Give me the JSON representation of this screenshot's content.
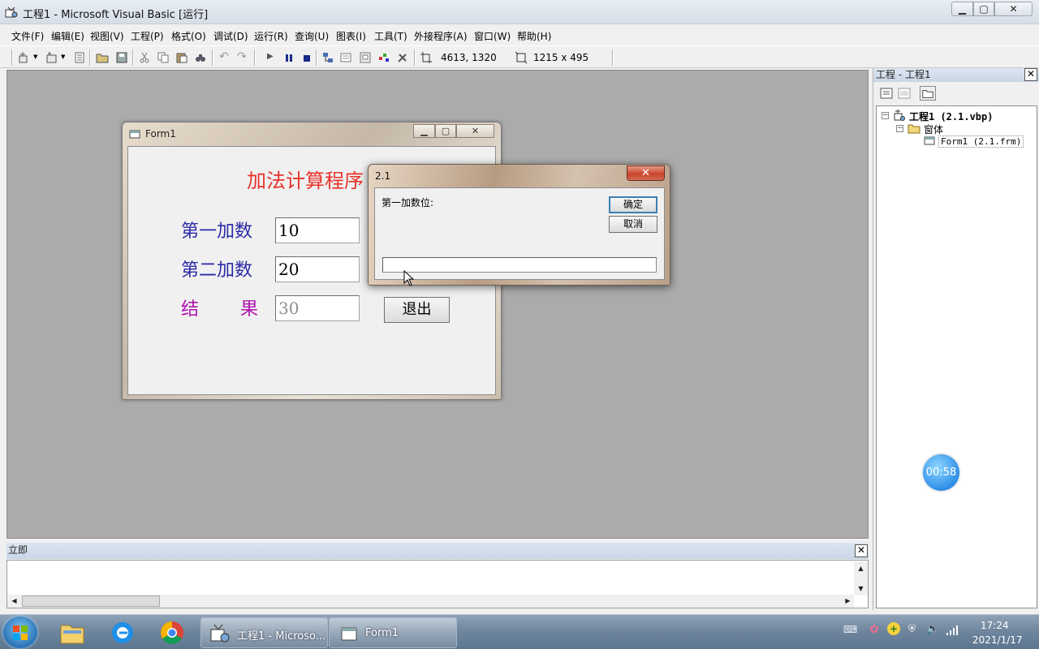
{
  "window": {
    "title": "工程1 - Microsoft Visual Basic [运行]",
    "controls": {
      "minimize": "▁",
      "maximize": "▢",
      "close": "✕"
    }
  },
  "menu": [
    {
      "label": "文件(F)"
    },
    {
      "label": "编辑(E)"
    },
    {
      "label": "视图(V)"
    },
    {
      "label": "工程(P)"
    },
    {
      "label": "格式(O)"
    },
    {
      "label": "调试(D)"
    },
    {
      "label": "运行(R)"
    },
    {
      "label": "查询(U)"
    },
    {
      "label": "图表(I)"
    },
    {
      "label": "工具(T)"
    },
    {
      "label": "外接程序(A)"
    },
    {
      "label": "窗口(W)"
    },
    {
      "label": "帮助(H)"
    }
  ],
  "toolbar": {
    "position": "4613, 1320",
    "size": "1215 x 495"
  },
  "form1": {
    "title": "Form1",
    "heading": "加法计算程序",
    "label1": "第一加数",
    "value1": "10",
    "label2": "第二加数",
    "value2": "20",
    "label3_a": "结",
    "label3_b": "果",
    "result": "30",
    "quit_label": "退出",
    "colors": {
      "heading": "#e8322a",
      "labels": "#2a2aa8",
      "result_label": "#b012b0"
    }
  },
  "inputbox": {
    "title": "2.1",
    "prompt": "第一加数位:",
    "ok_label": "确定",
    "cancel_label": "取消",
    "close_glyph": "✕",
    "input_value": ""
  },
  "project": {
    "header": "工程 - 工程1",
    "close_glyph": "✕",
    "tree": {
      "project": "工程1 (2.1.vbp)",
      "folder": "窗体",
      "form": "Form1 (2.1.frm)"
    }
  },
  "timer": {
    "value": "00:58"
  },
  "immediate": {
    "header": "立即",
    "close_glyph": "✕"
  },
  "taskbar": {
    "tasks": [
      {
        "label": "工程1 - Microso..."
      },
      {
        "label": "Form1"
      }
    ],
    "clock": {
      "time": "17:24",
      "date": "2021/1/17"
    }
  }
}
